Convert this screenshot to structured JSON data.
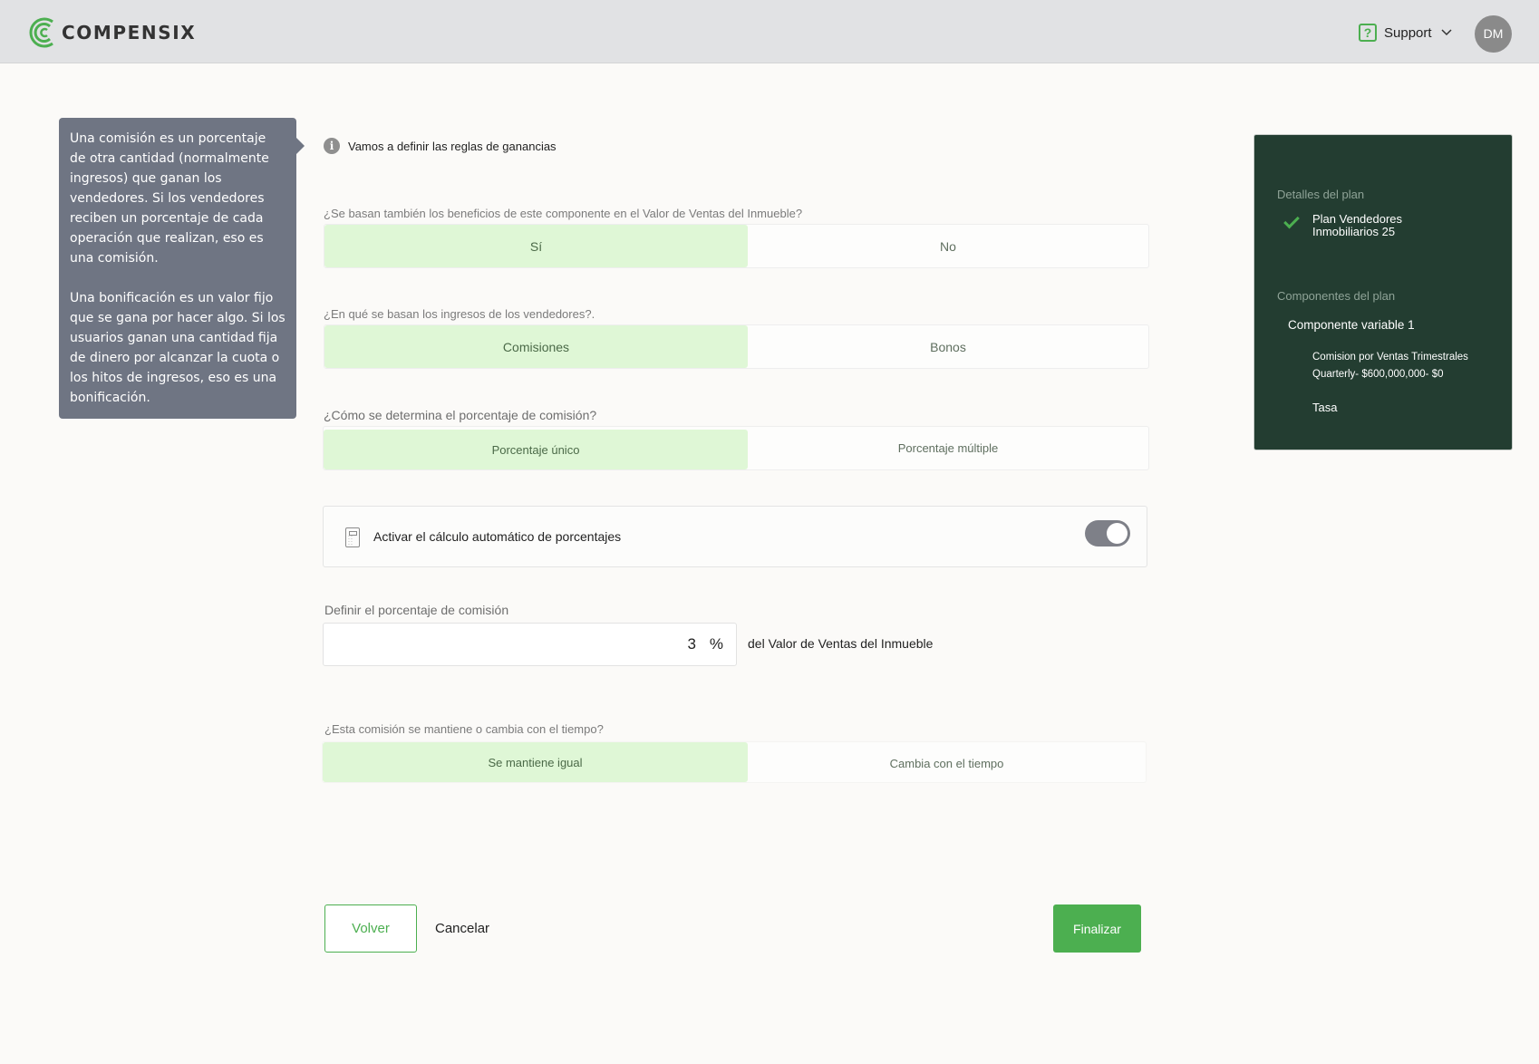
{
  "header": {
    "brand": "COMPENSIX",
    "support_label": "Support",
    "avatar_initials": "DM",
    "accent_color": "#4caf50"
  },
  "tooltip": {
    "paragraph1": "Una comisión es un porcentaje de otra cantidad (normalmente ingresos) que ganan los vendedores. Si los vendedores reciben un porcentaje de cada operación que realizan, eso es una comisión.",
    "paragraph2": "Una bonificación es un valor fijo que se gana por hacer algo. Si los usuarios ganan una cantidad fija de dinero por alcanzar la cuota o los hitos de ingresos, eso es una bonificación."
  },
  "intro": {
    "text": "Vamos a definir las reglas de ganancias"
  },
  "questions": {
    "q1": {
      "label": "¿Se basan también los beneficios de este componente en el Valor de Ventas del Inmueble?",
      "option_a": "Sí",
      "option_b": "No",
      "selected": "Sí"
    },
    "q2": {
      "label": "¿En qué se basan los ingresos de los vendedores?.",
      "option_a": "Comisiones",
      "option_b": "Bonos",
      "selected": "Comisiones"
    },
    "q3": {
      "label": "¿Cómo se determina el porcentaje de comisión?",
      "option_a": "Porcentaje único",
      "option_b": "Porcentaje múltiple",
      "selected": "Porcentaje único"
    },
    "q4": {
      "label": "¿Esta comisión se mantiene o cambia con el tiempo?",
      "option_a": "Se mantiene igual",
      "option_b": "Cambia con el tiempo",
      "selected": "Se mantiene igual"
    }
  },
  "auto_calc": {
    "label": "Activar el cálculo automático de porcentajes",
    "enabled": true
  },
  "percentage": {
    "label": "Definir el porcentaje de comisión",
    "value": "3",
    "unit": "%",
    "suffix": "del Valor de Ventas del Inmueble"
  },
  "actions": {
    "back": "Volver",
    "cancel": "Cancelar",
    "finish": "Finalizar"
  },
  "sidebar": {
    "details_title": "Detalles del plan",
    "plan_name": "Plan Vendedores Inmobiliarios 25",
    "components_title": "Componentes del plan",
    "component_name": "Componente variable 1",
    "component_detail": "Comision por Ventas Trimestrales Quarterly- $600,000,000- $0",
    "rate_label": "Tasa"
  }
}
